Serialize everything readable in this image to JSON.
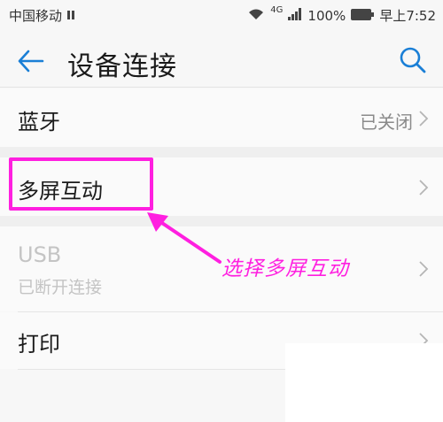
{
  "status_bar": {
    "carrier": "中国移动",
    "network": "4G",
    "battery": "100%",
    "time": "早上7:52"
  },
  "header": {
    "title": "设备连接"
  },
  "items": [
    {
      "label": "蓝牙",
      "value": "已关闭"
    },
    {
      "label": "多屏互动"
    },
    {
      "label": "USB",
      "sublabel": "已断开连接",
      "disabled": true
    },
    {
      "label": "打印"
    }
  ],
  "annotation": {
    "text": "选择多屏互动",
    "color": "#ff1fe0"
  },
  "colors": {
    "accent": "#1a7fd6",
    "annotation": "#ff1fe0"
  },
  "icons": [
    "back-arrow-icon",
    "search-icon",
    "chevron-right-icon",
    "wifi-icon",
    "signal-icon",
    "battery-icon"
  ]
}
